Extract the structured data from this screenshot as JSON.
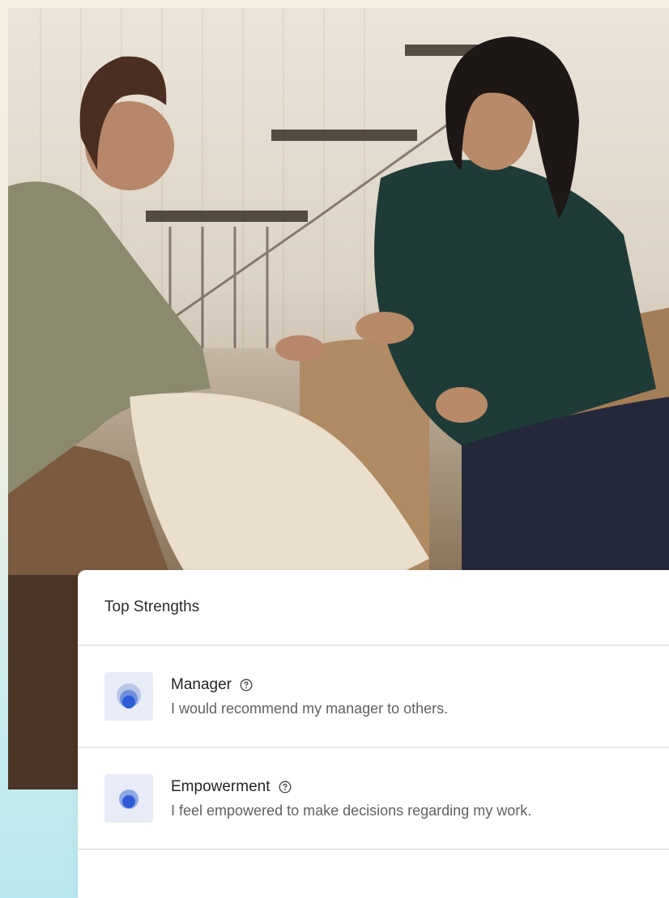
{
  "card": {
    "title": "Top Strengths",
    "items": [
      {
        "name": "Manager",
        "description": "I would recommend my manager to others.",
        "icon": "strength-level-icon",
        "help_icon": "help-icon"
      },
      {
        "name": "Empowerment",
        "description": "I feel empowered to make decisions regarding my work.",
        "icon": "strength-level-icon",
        "help_icon": "help-icon"
      }
    ]
  },
  "colors": {
    "accent": "#2f5cd6",
    "icon_bg": "#e8ecf7"
  }
}
